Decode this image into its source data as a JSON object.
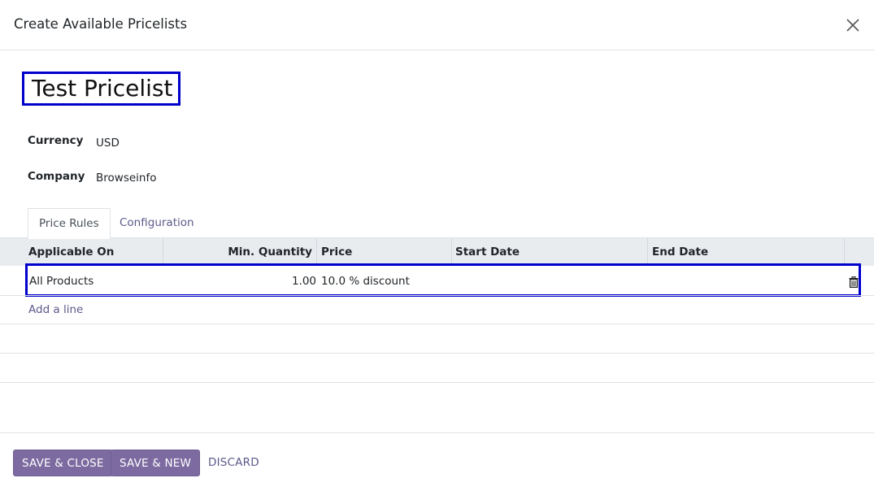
{
  "dialog": {
    "title": "Create Available Pricelists",
    "close_icon": "close-icon"
  },
  "record": {
    "name": "Test Pricelist"
  },
  "fields": {
    "currency_label": "Currency",
    "currency_value": "USD",
    "company_label": "Company",
    "company_value": "Browseinfo"
  },
  "tabs": [
    {
      "label": "Price Rules",
      "active": true
    },
    {
      "label": "Configuration",
      "active": false
    }
  ],
  "table": {
    "columns": [
      "Applicable On",
      "Min. Quantity",
      "Price",
      "Start Date",
      "End Date"
    ],
    "rows": [
      {
        "applicable_on": "All Products",
        "min_quantity": "1.00",
        "price": "10.0 % discount",
        "start_date": "",
        "end_date": "",
        "delete_icon": "trash-icon"
      }
    ],
    "add_line": "Add a line"
  },
  "footer": {
    "save_close": "SAVE & CLOSE",
    "save_new": "SAVE & NEW",
    "discard": "DISCARD"
  },
  "colors": {
    "primary": "#7c6aa0",
    "link": "#5c5a8a",
    "highlight": "#0000cc"
  }
}
